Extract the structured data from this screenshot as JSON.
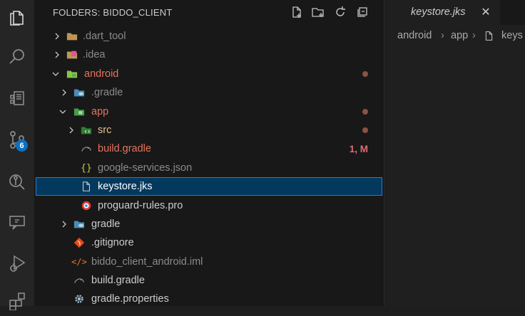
{
  "activity_bar": {
    "items": [
      {
        "name": "explorer-icon"
      },
      {
        "name": "search-icon"
      },
      {
        "name": "extensions-remote-icon"
      },
      {
        "name": "source-control-icon",
        "badge": "6"
      },
      {
        "name": "gitlens-icon"
      },
      {
        "name": "remote-explorer-icon"
      },
      {
        "name": "run-debug-icon"
      },
      {
        "name": "extensions-icon"
      }
    ]
  },
  "sidebar": {
    "title": "FOLDERS: BIDDO_CLIENT",
    "actions": [
      "new-file-icon",
      "new-folder-icon",
      "refresh-icon",
      "collapse-all-icon"
    ],
    "tree": [
      {
        "label": ".dart_tool",
        "color": "muted",
        "expanded": false,
        "folder": true
      },
      {
        "label": ".idea",
        "color": "muted",
        "expanded": false,
        "folder": true
      },
      {
        "label": "android",
        "color": "mod",
        "expanded": true,
        "folder": true,
        "dot": true
      },
      {
        "label": ".gradle",
        "color": "muted",
        "expanded": false,
        "folder": true
      },
      {
        "label": "app",
        "color": "mod",
        "expanded": true,
        "folder": true,
        "dot": true
      },
      {
        "label": "src",
        "color": "src",
        "expanded": false,
        "folder": true,
        "dot": true
      },
      {
        "label": "build.gradle",
        "color": "mod",
        "status": "1, M"
      },
      {
        "label": "google-services.json",
        "color": "muted"
      },
      {
        "label": "keystore.jks",
        "color": "white",
        "selected": true
      },
      {
        "label": "proguard-rules.pro",
        "color": "normal"
      },
      {
        "label": "gradle",
        "color": "normal",
        "expanded": false,
        "folder": true
      },
      {
        "label": ".gitignore",
        "color": "normal"
      },
      {
        "label": "biddo_client_android.iml",
        "color": "muted"
      },
      {
        "label": "build.gradle",
        "color": "normal"
      },
      {
        "label": "gradle.properties",
        "color": "normal"
      }
    ]
  },
  "editor": {
    "tab_label": "keystore.jks",
    "breadcrumb": [
      "android",
      "app",
      "keys"
    ]
  },
  "colors": {
    "modified": "#e5735d",
    "error_status": "#e06c75",
    "selection": "#04395e",
    "badge": "#0e70c0"
  }
}
